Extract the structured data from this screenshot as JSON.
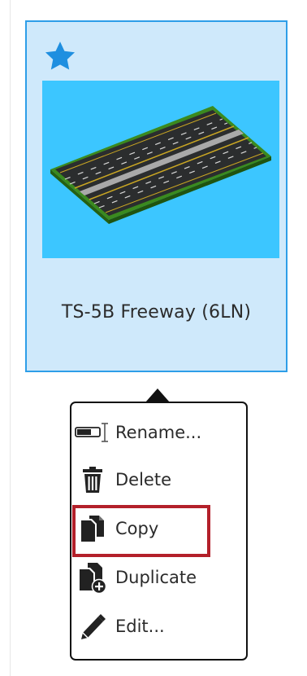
{
  "card": {
    "title": "TS-5B Freeway (6LN)",
    "favorite": true,
    "accent_color": "#2e9ee8",
    "background_color": "#cfe9fb",
    "thumbnail_background": "#3cc6ff"
  },
  "menu": {
    "items": [
      {
        "label": "Rename...",
        "icon": "rename-icon"
      },
      {
        "label": "Delete",
        "icon": "trash-icon"
      },
      {
        "label": "Copy",
        "icon": "copy-icon"
      },
      {
        "label": "Duplicate",
        "icon": "duplicate-icon"
      },
      {
        "label": "Edit...",
        "icon": "pencil-icon"
      }
    ],
    "highlighted_item": "Copy",
    "highlight_color": "#b3202a"
  }
}
